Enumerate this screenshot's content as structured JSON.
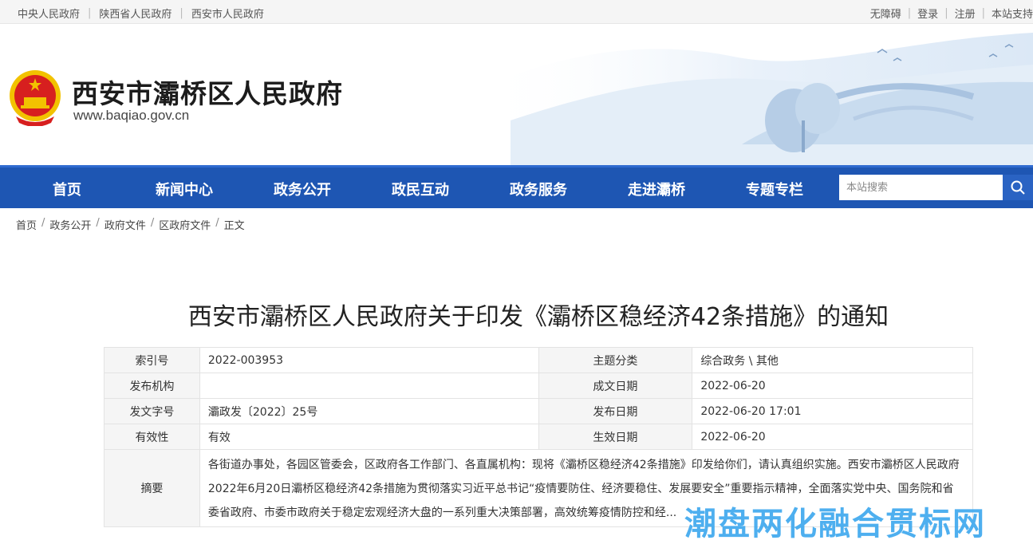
{
  "topbar": {
    "links_left": [
      "中央人民政府",
      "陕西省人民政府",
      "西安市人民政府"
    ],
    "links_right": [
      "无障碍",
      "登录",
      "注册",
      "本站支持"
    ]
  },
  "header": {
    "title": "西安市灞桥区人民政府",
    "url": "www.baqiao.gov.cn"
  },
  "nav": {
    "items": [
      "首页",
      "新闻中心",
      "政务公开",
      "政民互动",
      "政务服务",
      "走进灞桥",
      "专题专栏"
    ],
    "search_placeholder": "本站搜索"
  },
  "breadcrumb": [
    "首页",
    "政务公开",
    "政府文件",
    "区政府文件",
    "正文"
  ],
  "document": {
    "title": "西安市灞桥区人民政府关于印发《灞桥区稳经济42条措施》的通知",
    "info": {
      "index_label": "索引号",
      "index_value": "2022-003953",
      "topic_label": "主题分类",
      "topic_value": "综合政务 \\ 其他",
      "org_label": "发布机构",
      "org_value": "",
      "created_label": "成文日期",
      "created_value": "2022-06-20",
      "docno_label": "发文字号",
      "docno_value": "灞政发〔2022〕25号",
      "published_label": "发布日期",
      "published_value": "2022-06-20 17:01",
      "validity_label": "有效性",
      "validity_value": "有效",
      "effective_label": "生效日期",
      "effective_value": "2022-06-20",
      "abstract_label": "摘要",
      "abstract_value": "各街道办事处，各园区管委会，区政府各工作部门、各直属机构：现将《灞桥区稳经济42条措施》印发给你们，请认真组织实施。西安市灞桥区人民政府2022年6月20日灞桥区稳经济42条措施为贯彻落实习近平总书记“疫情要防住、经济要稳住、发展要安全”重要指示精神，全面落实党中央、国务院和省委省政府、市委市政府关于稳定宏观经济大盘的一系列重大决策部署，高效统筹疫情防控和经..."
    }
  },
  "watermark": "潮盘两化融合贯标网",
  "colors": {
    "nav_bg": "#1e56b3",
    "watermark": "#3fa9ee"
  },
  "icons": {
    "emblem": "national-emblem-icon",
    "search": "search-icon"
  }
}
